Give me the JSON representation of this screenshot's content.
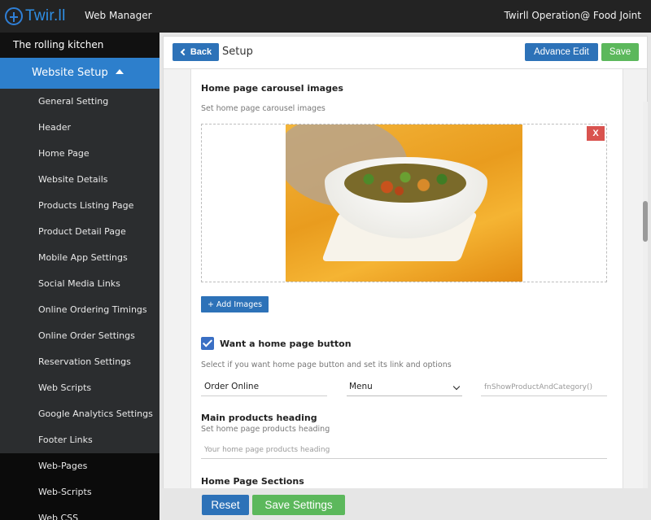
{
  "topbar": {
    "logo_text": "Twir.ll",
    "app_title": "Web Manager",
    "account": "Twirll Operation@ Food Joint"
  },
  "sidebar": {
    "restaurant": "The rolling kitchen",
    "section": "Website Setup",
    "items": [
      {
        "label": "General Setting"
      },
      {
        "label": "Header"
      },
      {
        "label": "Home Page"
      },
      {
        "label": "Website Details"
      },
      {
        "label": "Products Listing Page"
      },
      {
        "label": "Product Detail Page"
      },
      {
        "label": "Mobile App Settings"
      },
      {
        "label": "Social Media Links"
      },
      {
        "label": "Online Ordering Timings"
      },
      {
        "label": "Online Order Settings"
      },
      {
        "label": "Reservation Settings"
      },
      {
        "label": "Web Scripts"
      },
      {
        "label": "Google Analytics Settings"
      },
      {
        "label": "Footer Links"
      }
    ],
    "sections": [
      {
        "label": "Web-Pages"
      },
      {
        "label": "Web-Scripts"
      },
      {
        "label": "Web CSS"
      }
    ]
  },
  "header": {
    "back_label": "Back",
    "title": "Setup",
    "advance_edit_label": "Advance Edit",
    "save_label": "Save"
  },
  "carousel": {
    "heading": "Home page carousel images",
    "hint": "Set home page carousel images",
    "remove_label": "X",
    "add_label": "+ Add Images"
  },
  "home_button": {
    "checked": true,
    "label": "Want a home page button",
    "hint": "Select if you want home page button and set its link and options",
    "text_value": "Order Online",
    "select_value": "Menu",
    "function_value": "fnShowProductAndCategory()"
  },
  "products": {
    "heading": "Main products heading",
    "hint": "Set home page products heading",
    "placeholder": "Your home page products heading"
  },
  "sections": {
    "heading": "Home Page Sections"
  },
  "footer": {
    "reset_label": "Reset",
    "save_settings_label": "Save Settings"
  },
  "colors": {
    "primary": "#2d72b8",
    "success": "#5cb85c",
    "danger": "#d9534f",
    "sidebar_bg": "#2b2d2f",
    "sidebar_active": "#2d7fcc"
  }
}
